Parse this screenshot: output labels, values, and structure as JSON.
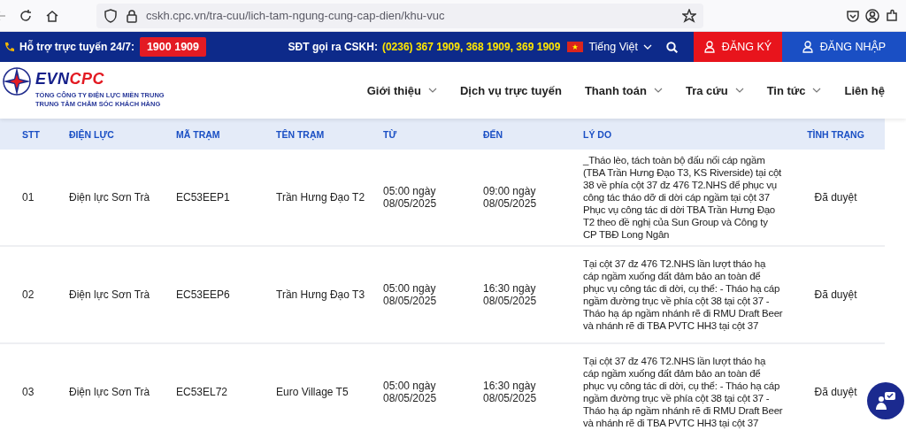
{
  "browser": {
    "url": "cskh.cpc.vn/tra-cuu/lich-tam-ngung-cung-cap-dien/khu-vuc"
  },
  "top_bar": {
    "support_label": "Hỗ trợ trực tuyến 24/7:",
    "hotline": "1900 1909",
    "cskh_label": "SĐT gọi ra CSKH:",
    "cskh_numbers": "(0236) 367 1909, 368 1909, 369 1909",
    "language": "Tiếng Việt",
    "register": "ĐĂNG KÝ",
    "login": "ĐĂNG NHẬP"
  },
  "header": {
    "logo": {
      "brand_evn": "EVN",
      "brand_cpc": "CPC",
      "line_1": "TỔNG CÔNG TY ĐIỆN LỰC MIỀN TRUNG",
      "line_2": "TRUNG TÂM CHĂM SÓC KHÁCH HÀNG"
    },
    "nav": [
      {
        "label": "Giới thiệu",
        "has_menu": true
      },
      {
        "label": "Dịch vụ trực tuyến",
        "has_menu": false
      },
      {
        "label": "Thanh toán",
        "has_menu": true
      },
      {
        "label": "Tra cứu",
        "has_menu": true
      },
      {
        "label": "Tin tức",
        "has_menu": true
      },
      {
        "label": "Liên hệ",
        "has_menu": false
      }
    ]
  },
  "table": {
    "columns": [
      "STT",
      "ĐIỆN LỰC",
      "MÃ TRẠM",
      "TÊN TRẠM",
      "TỪ",
      "ĐẾN",
      "LÝ DO",
      "TÌNH TRẠNG"
    ],
    "rows": [
      {
        "stt": "01",
        "dien_luc": "Điện lực Sơn Trà",
        "ma_tram": "EC53EEP1",
        "ten_tram": "Trần Hưng Đạo T2",
        "tu": "05:00 ngày 08/05/2025",
        "den": "09:00 ngày 08/05/2025",
        "ly_do": "_Tháo lèo, tách toàn bộ đấu nối cáp ngầm (TBA Trần Hưng Đạo T3, KS Riverside) tại cột 38 về phía cột 37 đz 476 T2.NHS để phục vụ công tác tháo dỡ di dời cáp ngầm tại cột 37 Phục vụ công tác di dời TBA Trần Hưng Đạo T2 theo đề nghị của Sun Group và Công ty CP TBĐ Long Ngân",
        "tinh_trang": "Đã duyệt"
      },
      {
        "stt": "02",
        "dien_luc": "Điện lực Sơn Trà",
        "ma_tram": "EC53EEP6",
        "ten_tram": "Trần Hưng Đạo T3",
        "tu": "05:00 ngày 08/05/2025",
        "den": "16:30 ngày 08/05/2025",
        "ly_do": "Tại cột 37 đz 476 T2.NHS lần lượt tháo hạ cáp ngầm xuống đất đảm bảo an toàn để phục vụ công tác di dời, cụ thể: - Tháo hạ cáp ngầm đường trục về phía cột 38 tại cột 37 - Tháo hạ áp ngầm nhánh rẽ đi RMU Draft Beer và nhánh rẽ đi TBA PVTC HH3 tại cột 37",
        "tinh_trang": "Đã duyệt"
      },
      {
        "stt": "03",
        "dien_luc": "Điện lực Sơn Trà",
        "ma_tram": "EC53EL72",
        "ten_tram": "Euro Village T5",
        "tu": "05:00 ngày 08/05/2025",
        "den": "16:30 ngày 08/05/2025",
        "ly_do": "Tại cột 37 đz 476 T2.NHS lần lượt tháo hạ cáp ngầm xuống đất đảm bảo an toàn để phục vụ công tác di dời, cụ thể: - Tháo hạ cáp ngầm đường trục về phía cột 38 tại cột 37 - Tháo hạ áp ngầm nhánh rẽ đi RMU Draft Beer và nhánh rẽ đi TBA PVTC HH3 tại cột 37",
        "tinh_trang": "Đã duyệt"
      }
    ]
  }
}
